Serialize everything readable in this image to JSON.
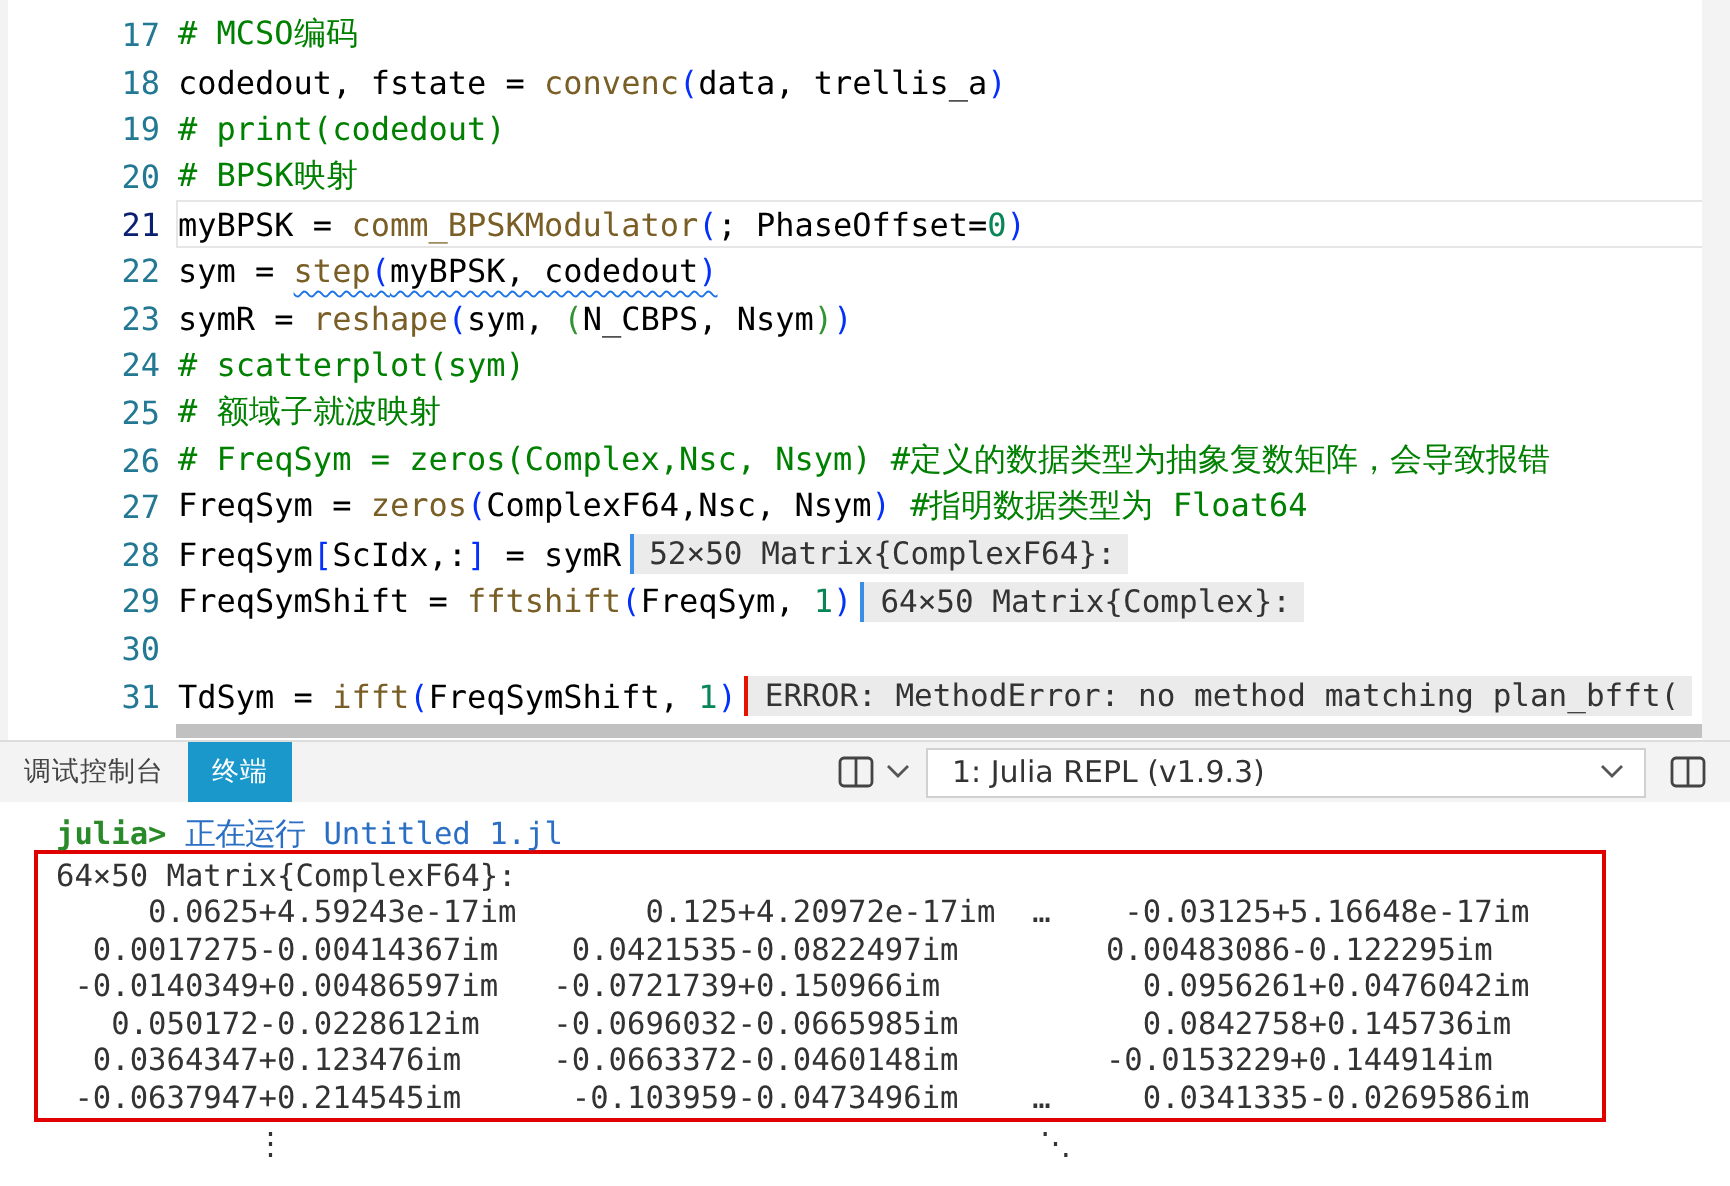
{
  "editor": {
    "lines": [
      {
        "number": "17",
        "current": false,
        "segments": [
          {
            "kind": "comment",
            "text": "# MCSO编码"
          }
        ]
      },
      {
        "number": "18",
        "current": false,
        "segments": [
          {
            "kind": "text",
            "text": "codedout, fstate = "
          },
          {
            "kind": "func",
            "text": "convenc"
          },
          {
            "kind": "paren",
            "text": "("
          },
          {
            "kind": "text",
            "text": "data, trellis_a"
          },
          {
            "kind": "paren",
            "text": ")"
          }
        ]
      },
      {
        "number": "19",
        "current": false,
        "segments": [
          {
            "kind": "comment",
            "text": "# print(codedout)"
          }
        ]
      },
      {
        "number": "20",
        "current": false,
        "segments": [
          {
            "kind": "comment",
            "text": "# BPSK映射"
          }
        ]
      },
      {
        "number": "21",
        "current": true,
        "segments": [
          {
            "kind": "text",
            "text": "myBPSK = "
          },
          {
            "kind": "func",
            "text": "comm_BPSKModulator"
          },
          {
            "kind": "paren",
            "text": "("
          },
          {
            "kind": "text",
            "text": "; PhaseOffset="
          },
          {
            "kind": "num",
            "text": "0"
          },
          {
            "kind": "paren",
            "text": ")"
          }
        ]
      },
      {
        "number": "22",
        "current": false,
        "segments": [
          {
            "kind": "text",
            "text": "sym = "
          },
          {
            "kind": "func-warn",
            "text": "step"
          },
          {
            "kind": "paren-warn",
            "text": "("
          },
          {
            "kind": "text-warn",
            "text": "myBPSK, codedout"
          },
          {
            "kind": "paren-warn",
            "text": ")"
          }
        ]
      },
      {
        "number": "23",
        "current": false,
        "segments": [
          {
            "kind": "text",
            "text": "symR = "
          },
          {
            "kind": "func",
            "text": "reshape"
          },
          {
            "kind": "paren",
            "text": "("
          },
          {
            "kind": "text",
            "text": "sym, "
          },
          {
            "kind": "paren2",
            "text": "("
          },
          {
            "kind": "text",
            "text": "N_CBPS, Nsym"
          },
          {
            "kind": "paren2",
            "text": ")"
          },
          {
            "kind": "paren",
            "text": ")"
          }
        ]
      },
      {
        "number": "24",
        "current": false,
        "segments": [
          {
            "kind": "comment",
            "text": "# scatterplot(sym)"
          }
        ]
      },
      {
        "number": "25",
        "current": false,
        "segments": [
          {
            "kind": "comment",
            "text": "# 额域子就波映射"
          }
        ]
      },
      {
        "number": "26",
        "current": false,
        "segments": [
          {
            "kind": "comment",
            "text": "# FreqSym = zeros(Complex,Nsc, Nsym) #定义的数据类型为抽象复数矩阵，会导致报错"
          }
        ]
      },
      {
        "number": "27",
        "current": false,
        "segments": [
          {
            "kind": "text",
            "text": "FreqSym = "
          },
          {
            "kind": "func",
            "text": "zeros"
          },
          {
            "kind": "paren",
            "text": "("
          },
          {
            "kind": "text",
            "text": "ComplexF64,Nsc, Nsym"
          },
          {
            "kind": "paren",
            "text": ")"
          },
          {
            "kind": "comment",
            "text": " #指明数据类型为 Float64"
          }
        ]
      },
      {
        "number": "28",
        "current": false,
        "segments": [
          {
            "kind": "text",
            "text": "FreqSym"
          },
          {
            "kind": "paren",
            "text": "["
          },
          {
            "kind": "text",
            "text": "ScIdx,:"
          },
          {
            "kind": "paren",
            "text": "]"
          },
          {
            "kind": "text",
            "text": " = symR"
          }
        ],
        "result": {
          "kind": "value",
          "text": "52×50 Matrix{ComplexF64}:"
        }
      },
      {
        "number": "29",
        "current": false,
        "segments": [
          {
            "kind": "text",
            "text": "FreqSymShift = "
          },
          {
            "kind": "func",
            "text": "fftshift"
          },
          {
            "kind": "paren",
            "text": "("
          },
          {
            "kind": "text",
            "text": "FreqSym, "
          },
          {
            "kind": "num",
            "text": "1"
          },
          {
            "kind": "paren",
            "text": ")"
          }
        ],
        "result": {
          "kind": "value",
          "text": "64×50 Matrix{Complex}:"
        }
      },
      {
        "number": "30",
        "current": false
      },
      {
        "number": "31",
        "current": false,
        "segments": [
          {
            "kind": "text",
            "text": "TdSym = "
          },
          {
            "kind": "func",
            "text": "ifft"
          },
          {
            "kind": "paren",
            "text": "("
          },
          {
            "kind": "text",
            "text": "FreqSymShift, "
          },
          {
            "kind": "num",
            "text": "1"
          },
          {
            "kind": "paren",
            "text": ")"
          }
        ],
        "result": {
          "kind": "error",
          "text": "ERROR: MethodError: no method matching plan_bfft("
        }
      }
    ]
  },
  "panel": {
    "tabs": [
      {
        "label": "调试控制台",
        "selected": false
      },
      {
        "label": "终端",
        "selected": true
      }
    ],
    "terminal_select": {
      "value": "1: Julia REPL (v1.9.3)"
    }
  },
  "terminal": {
    "prompt": "julia>",
    "command": "正在运行 Untitled 1.jl",
    "highlighted": true,
    "output_header": "64×50 Matrix{ComplexF64}:",
    "rows": [
      "     0.0625+4.59243e-17im       0.125+4.20972e-17im  …    -0.03125+5.16648e-17im",
      "  0.0017275-0.00414367im    0.0421535-0.0822497im        0.00483086-0.122295im",
      " -0.0140349+0.00486597im   -0.0721739+0.150966im           0.0956261+0.0476042im",
      "   0.050172-0.0228612im    -0.0696032-0.0665985im          0.0842758+0.145736im",
      "  0.0364347+0.123476im     -0.0663372-0.0460148im        -0.0153229+0.144914im",
      " -0.0637947+0.214545im      -0.103959-0.0473496im    …     0.0341335-0.0269586im"
    ],
    "ellipsis_row": "           ⋮                                         ⋱"
  }
}
